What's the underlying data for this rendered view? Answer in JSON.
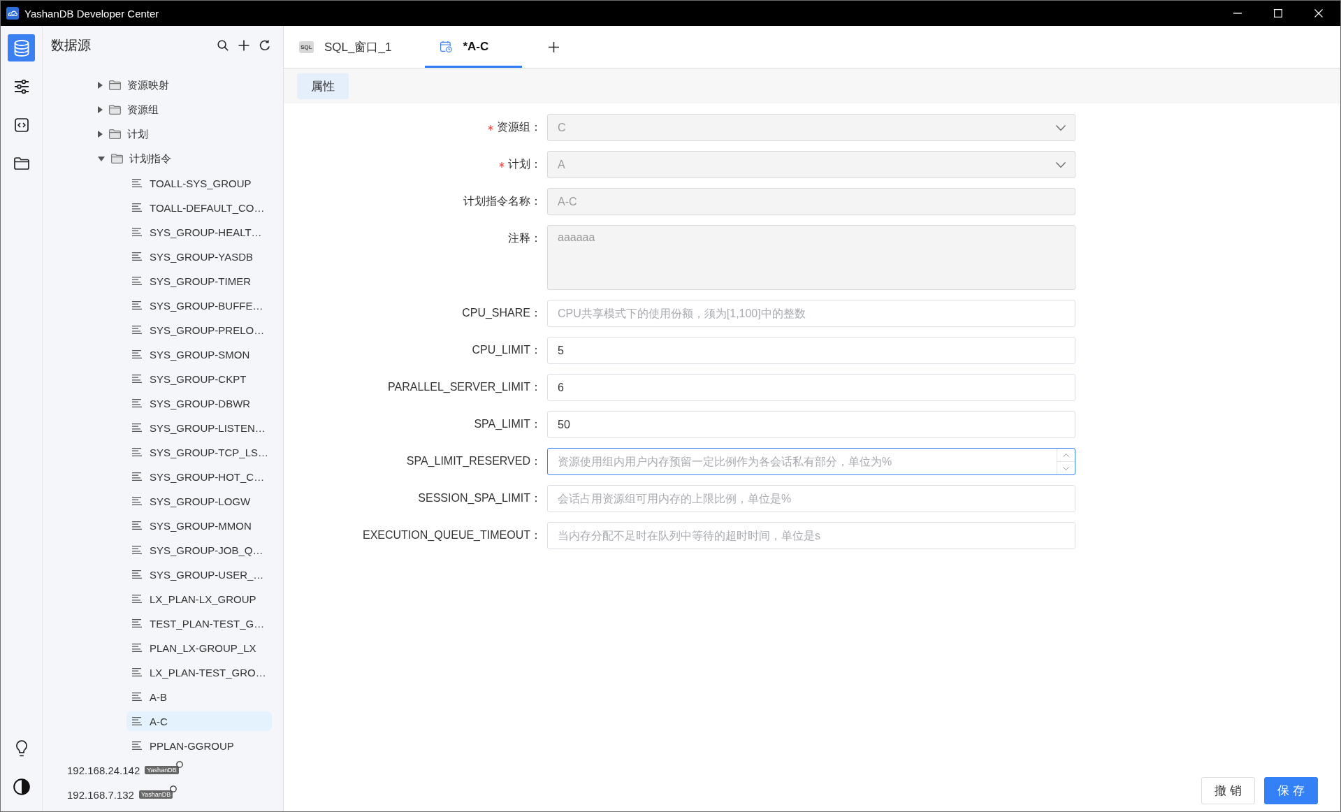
{
  "window": {
    "title": "YashanDB Developer Center"
  },
  "rail": {
    "items": [
      {
        "selected": true
      },
      {
        "selected": false
      },
      {
        "selected": false
      },
      {
        "selected": false
      }
    ]
  },
  "sidebar": {
    "title": "数据源",
    "tree": [
      {
        "kind": "folder",
        "label": "资源映射",
        "expanded": false,
        "selected": false
      },
      {
        "kind": "folder",
        "label": "资源组",
        "expanded": false,
        "selected": false
      },
      {
        "kind": "folder",
        "label": "计划",
        "expanded": false,
        "selected": false
      },
      {
        "kind": "folder",
        "label": "计划指令",
        "expanded": true,
        "selected": false,
        "children": [
          {
            "kind": "item",
            "label": "TOALL-SYS_GROUP",
            "selected": false
          },
          {
            "kind": "item",
            "label": "TOALL-DEFAULT_CO…",
            "selected": false
          },
          {
            "kind": "item",
            "label": "SYS_GROUP-HEALT…",
            "selected": false
          },
          {
            "kind": "item",
            "label": "SYS_GROUP-YASDB",
            "selected": false
          },
          {
            "kind": "item",
            "label": "SYS_GROUP-TIMER",
            "selected": false
          },
          {
            "kind": "item",
            "label": "SYS_GROUP-BUFFE…",
            "selected": false
          },
          {
            "kind": "item",
            "label": "SYS_GROUP-PRELO…",
            "selected": false
          },
          {
            "kind": "item",
            "label": "SYS_GROUP-SMON",
            "selected": false
          },
          {
            "kind": "item",
            "label": "SYS_GROUP-CKPT",
            "selected": false
          },
          {
            "kind": "item",
            "label": "SYS_GROUP-DBWR",
            "selected": false
          },
          {
            "kind": "item",
            "label": "SYS_GROUP-LISTEN…",
            "selected": false
          },
          {
            "kind": "item",
            "label": "SYS_GROUP-TCP_LS…",
            "selected": false
          },
          {
            "kind": "item",
            "label": "SYS_GROUP-HOT_C…",
            "selected": false
          },
          {
            "kind": "item",
            "label": "SYS_GROUP-LOGW",
            "selected": false
          },
          {
            "kind": "item",
            "label": "SYS_GROUP-MMON",
            "selected": false
          },
          {
            "kind": "item",
            "label": "SYS_GROUP-JOB_Q…",
            "selected": false
          },
          {
            "kind": "item",
            "label": "SYS_GROUP-USER_…",
            "selected": false
          },
          {
            "kind": "item",
            "label": "LX_PLAN-LX_GROUP",
            "selected": false
          },
          {
            "kind": "item",
            "label": "TEST_PLAN-TEST_G…",
            "selected": false
          },
          {
            "kind": "item",
            "label": "PLAN_LX-GROUP_LX",
            "selected": false
          },
          {
            "kind": "item",
            "label": "LX_PLAN-TEST_GRO…",
            "selected": false
          },
          {
            "kind": "item",
            "label": "A-B",
            "selected": false
          },
          {
            "kind": "item",
            "label": "A-C",
            "selected": true
          },
          {
            "kind": "item",
            "label": "PPLAN-GGROUP",
            "selected": false
          }
        ]
      }
    ],
    "connections": [
      {
        "host": "192.168.24.142",
        "badge": "YashanDB",
        "selected": false
      },
      {
        "host": "192.168.7.132",
        "badge": "YashanDB",
        "selected": false
      }
    ]
  },
  "tabs": [
    {
      "kind": "sql",
      "icon_label": "SQL",
      "label": "SQL_窗口_1",
      "selected": false
    },
    {
      "kind": "plan",
      "label": "*A-C",
      "selected": true
    }
  ],
  "subtabs": [
    {
      "label": "属性",
      "selected": true
    }
  ],
  "form": {
    "fields": [
      {
        "kind": "select",
        "label": "资源组：",
        "required": true,
        "disabled": true,
        "focused": false,
        "value": "C"
      },
      {
        "kind": "select",
        "label": "计划：",
        "required": true,
        "disabled": true,
        "focused": false,
        "value": "A"
      },
      {
        "kind": "text",
        "label": "计划指令名称：",
        "required": false,
        "disabled": true,
        "focused": false,
        "value": "A-C"
      },
      {
        "kind": "textarea",
        "label": "注释：",
        "required": false,
        "disabled": true,
        "focused": false,
        "value": "aaaaaa"
      },
      {
        "kind": "number",
        "label": "CPU_SHARE：",
        "required": false,
        "disabled": false,
        "focused": false,
        "placeholder": "CPU共享模式下的使用份额，须为[1,100]中的整数"
      },
      {
        "kind": "number",
        "label": "CPU_LIMIT：",
        "required": false,
        "disabled": false,
        "focused": false,
        "value": "5"
      },
      {
        "kind": "number",
        "label": "PARALLEL_SERVER_LIMIT：",
        "required": false,
        "disabled": false,
        "focused": false,
        "value": "6"
      },
      {
        "kind": "number",
        "label": "SPA_LIMIT：",
        "required": false,
        "disabled": false,
        "focused": false,
        "value": "50"
      },
      {
        "kind": "number",
        "label": "SPA_LIMIT_RESERVED：",
        "required": false,
        "disabled": false,
        "focused": true,
        "placeholder": "资源使用组内用户内存预留一定比例作为各会话私有部分，单位为%"
      },
      {
        "kind": "number",
        "label": "SESSION_SPA_LIMIT：",
        "required": false,
        "disabled": false,
        "focused": false,
        "placeholder": "会话占用资源组可用内存的上限比例，单位是%"
      },
      {
        "kind": "number",
        "label": "EXECUTION_QUEUE_TIMEOUT：",
        "required": false,
        "disabled": false,
        "focused": false,
        "placeholder": "当内存分配不足时在队列中等待的超时时间，单位是s"
      }
    ]
  },
  "actions": [
    {
      "kind": "secondary",
      "label": "撤 销"
    },
    {
      "kind": "primary",
      "label": "保 存"
    }
  ]
}
